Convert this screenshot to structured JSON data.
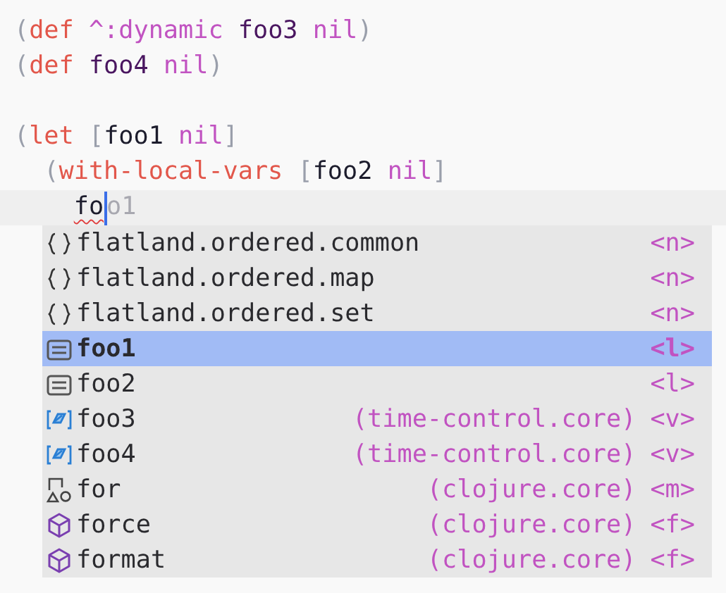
{
  "editor": {
    "lines": [
      {
        "current": false,
        "tokens": [
          {
            "text": "(",
            "kind": "open"
          },
          {
            "text": "def",
            "kind": "keyword"
          },
          {
            "text": "^:dynamic",
            "kind": "meta"
          },
          {
            "text": "foo3",
            "kind": "defname"
          },
          {
            "text": "nil",
            "kind": "literal"
          },
          {
            "text": ")",
            "kind": "close"
          }
        ]
      },
      {
        "current": false,
        "tokens": [
          {
            "text": "(",
            "kind": "open"
          },
          {
            "text": "def",
            "kind": "keyword"
          },
          {
            "text": "foo4",
            "kind": "defname"
          },
          {
            "text": "nil",
            "kind": "literal"
          },
          {
            "text": ")",
            "kind": "close"
          }
        ]
      },
      {
        "current": false
      },
      {
        "current": false,
        "tokens": [
          {
            "text": "(",
            "kind": "open"
          },
          {
            "text": "let",
            "kind": "keyword"
          },
          {
            "text": "[",
            "kind": "open"
          },
          {
            "text": "foo1",
            "kind": "symbol"
          },
          {
            "text": "nil",
            "kind": "literal"
          },
          {
            "text": "]",
            "kind": "close"
          }
        ],
        "children": [
          {
            "current": false,
            "tokens": [
              {
                "text": "(",
                "kind": "open"
              },
              {
                "text": "with-local-vars",
                "kind": "keyword"
              },
              {
                "text": "[",
                "kind": "open"
              },
              {
                "text": "foo2",
                "kind": "symbol"
              },
              {
                "text": "nil",
                "kind": "literal"
              },
              {
                "text": "]",
                "kind": "close"
              }
            ],
            "children": [
              {
                "current": true,
                "typed": "fo",
                "hint": "o1"
              }
            ]
          }
        ]
      }
    ]
  },
  "completion": {
    "items": [
      {
        "kind": "namespace",
        "label": "flatland.ordered.common",
        "type": "<n>",
        "selected": false
      },
      {
        "kind": "namespace",
        "label": "flatland.ordered.map",
        "type": "<n>",
        "selected": false
      },
      {
        "kind": "namespace",
        "label": "flatland.ordered.set",
        "type": "<n>",
        "selected": false
      },
      {
        "kind": "local",
        "label": "foo1",
        "type": "<l>",
        "selected": true
      },
      {
        "kind": "local",
        "label": "foo2",
        "type": "<l>",
        "selected": false
      },
      {
        "kind": "var",
        "label": "foo3",
        "ns": "(time-control.core)",
        "type": "<v>",
        "selected": false
      },
      {
        "kind": "var",
        "label": "foo4",
        "ns": "(time-control.core)",
        "type": "<v>",
        "selected": false
      },
      {
        "kind": "macro",
        "label": "for",
        "ns": "(clojure.core)",
        "type": "<m>",
        "selected": false
      },
      {
        "kind": "function",
        "label": "force",
        "ns": "(clojure.core)",
        "type": "<f>",
        "selected": false
      },
      {
        "kind": "function",
        "label": "format",
        "ns": "(clojure.core)",
        "type": "<f>",
        "selected": false
      }
    ]
  }
}
